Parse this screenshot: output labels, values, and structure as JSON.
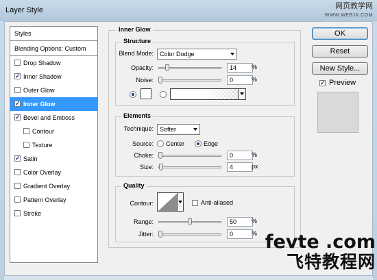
{
  "window": {
    "title": "Layer Style"
  },
  "watermark_top": {
    "line1": "网页教学网",
    "line2": "WWW.WEBJX.COM"
  },
  "watermark_bottom": {
    "line1": "fevte .com",
    "line2": "飞特教程网"
  },
  "styles_list": {
    "header": "Styles",
    "blending": "Blending Options: Custom",
    "items": [
      {
        "label": "Drop Shadow",
        "checked": false,
        "indent": false,
        "selected": false
      },
      {
        "label": "Inner Shadow",
        "checked": true,
        "indent": false,
        "selected": false
      },
      {
        "label": "Outer Glow",
        "checked": false,
        "indent": false,
        "selected": false
      },
      {
        "label": "Inner Glow",
        "checked": true,
        "indent": false,
        "selected": true
      },
      {
        "label": "Bevel and Emboss",
        "checked": true,
        "indent": false,
        "selected": false
      },
      {
        "label": "Contour",
        "checked": false,
        "indent": true,
        "selected": false
      },
      {
        "label": "Texture",
        "checked": false,
        "indent": true,
        "selected": false
      },
      {
        "label": "Satin",
        "checked": true,
        "indent": false,
        "selected": false
      },
      {
        "label": "Color Overlay",
        "checked": false,
        "indent": false,
        "selected": false
      },
      {
        "label": "Gradient Overlay",
        "checked": false,
        "indent": false,
        "selected": false
      },
      {
        "label": "Pattern Overlay",
        "checked": false,
        "indent": false,
        "selected": false
      },
      {
        "label": "Stroke",
        "checked": false,
        "indent": false,
        "selected": false
      }
    ]
  },
  "panel": {
    "title": "Inner Glow",
    "structure": {
      "title": "Structure",
      "blend_mode_label": "Blend Mode:",
      "blend_mode_value": "Color Dodge",
      "opacity_label": "Opacity:",
      "opacity_value": "14",
      "noise_label": "Noise:",
      "noise_value": "0",
      "percent": "%",
      "color_radio_selected": "solid"
    },
    "elements": {
      "title": "Elements",
      "technique_label": "Technique:",
      "technique_value": "Softer",
      "source_label": "Source:",
      "source_center": "Center",
      "source_edge": "Edge",
      "source_selected": "edge",
      "choke_label": "Choke:",
      "choke_value": "0",
      "size_label": "Size:",
      "size_value": "4",
      "percent": "%",
      "px": "px"
    },
    "quality": {
      "title": "Quality",
      "contour_label": "Contour:",
      "anti_aliased_label": "Anti-aliased",
      "anti_aliased_checked": false,
      "range_label": "Range:",
      "range_value": "50",
      "jitter_label": "Jitter:",
      "jitter_value": "0",
      "percent": "%"
    }
  },
  "buttons": {
    "ok": "OK",
    "reset": "Reset",
    "new_style": "New Style...",
    "preview": "Preview",
    "preview_checked": true
  }
}
